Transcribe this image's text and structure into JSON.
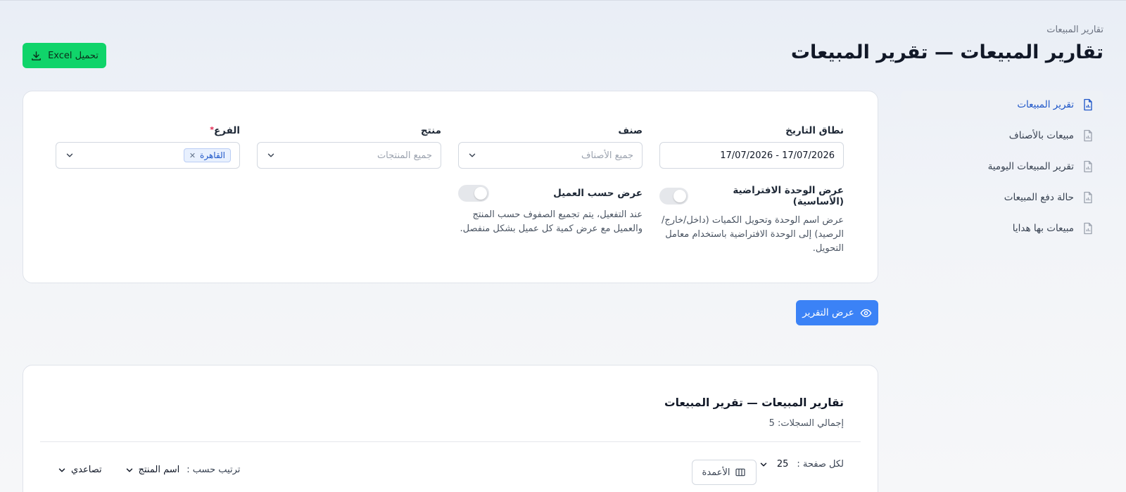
{
  "header": {
    "breadcrumb": "تقارير المبيعات",
    "title": "تقارير المبيعات — تقرير المبيعات",
    "excel_label": "تحميل Excel"
  },
  "sidebar": {
    "items": [
      {
        "label": "تقرير المبيعات",
        "active": true
      },
      {
        "label": "مبيعات بالأصناف"
      },
      {
        "label": "تقرير المبيعات اليومية"
      },
      {
        "label": "حالة دفع المبيعات"
      },
      {
        "label": "مبيعات بها هدايا"
      }
    ]
  },
  "filters": {
    "date_range": {
      "label": "نطاق التاريخ",
      "value": "17/07/2026 - 17/07/2026"
    },
    "category": {
      "label": "صنف",
      "placeholder": "جميع الأصناف"
    },
    "product": {
      "label": "منتج",
      "placeholder": "جميع المنتجات"
    },
    "branch": {
      "label": "الفرع",
      "required_mark": "*",
      "chip": "القاهرة"
    },
    "toggle_unit": {
      "label": "عرض الوحدة الافتراضية (الأساسية)",
      "description": "عرض اسم الوحدة وتحويل الكميات (داخل/خارج/الرصيد) إلى الوحدة الافتراضية باستخدام معامل التحويل."
    },
    "toggle_customer": {
      "label": "عرض حسب العميل",
      "description": "عند التفعيل، يتم تجميع الصفوف حسب المنتج والعميل مع عرض كمية كل عميل بشكل منفصل."
    }
  },
  "show_report_label": "عرض التقرير",
  "results": {
    "title": "تقارير المبيعات — تقرير المبيعات",
    "count_label": "إجمالي السجلات: 5",
    "per_page_label": "لكل صفحة :",
    "per_page_value": "25",
    "columns_label": "الأعمدة",
    "sort_label": "ترتيب حسب :",
    "sort_field": "اسم المنتج",
    "sort_order": "تصاعدي"
  },
  "colors": {
    "excel_button": "#10d46a",
    "primary_button": "#3b82f6",
    "active_link": "#1e56c8"
  }
}
